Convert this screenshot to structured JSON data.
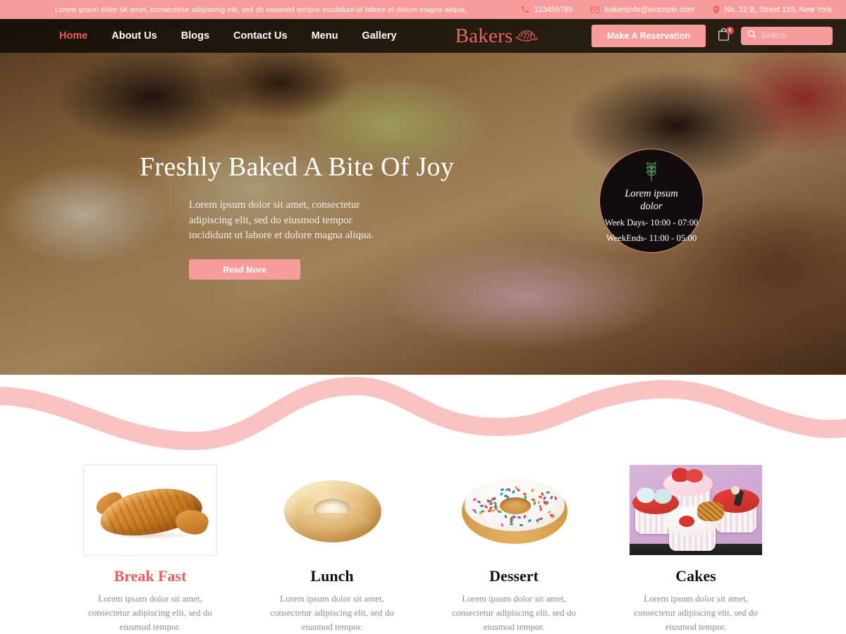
{
  "topbar": {
    "tagline": "Lorem ipsum dolor sit amet, consectetur adipiscing elit, sed do eiusmod tempor incididunt ut labore et dolore magna aliqua.",
    "phone": "123456789",
    "email": "bakersinfo@example.com",
    "address": "No. 22 B, Street 123, New York"
  },
  "nav": {
    "links": [
      {
        "label": "Home",
        "active": true
      },
      {
        "label": "About Us",
        "active": false
      },
      {
        "label": "Blogs",
        "active": false
      },
      {
        "label": "Contact Us",
        "active": false
      },
      {
        "label": "Menu",
        "active": false
      },
      {
        "label": "Gallery",
        "active": false
      }
    ],
    "brand": "Bakers",
    "reserve_label": "Make A Reservation",
    "cart_badge": "0",
    "search_placeholder": "Search",
    "search_value": ""
  },
  "hero": {
    "title": "Freshly Baked A Bite Of Joy",
    "description": "Lorem ipsum dolor sit amet, consectetur adipiscing elit, sed do eiusmod tempor incididunt ut labore et dolore magna aliqua.",
    "cta_label": "Read More",
    "hours": {
      "title": "Lorem ipsum dolor",
      "weekdays": "Week Days- 10:00 - 07:00",
      "weekends": "WeekEnds- 11:00 - 05:00"
    }
  },
  "categories": [
    {
      "title": "Break Fast",
      "description": "Lorem ipsum dolor sit amet, consectetur adipiscing elit, sed do eiusmod tempor.",
      "image": "croissant-photo",
      "accent": true
    },
    {
      "title": "Lunch",
      "description": "Lorem ipsum dolor sit amet, consectetur adipiscing elit, sed do eiusmod tempor.",
      "image": "bagel-photo",
      "accent": false
    },
    {
      "title": "Dessert",
      "description": "Lorem ipsum dolor sit amet, consectetur adipiscing elit, sed do eiusmod tempor.",
      "image": "sprinkle-donut-photo",
      "accent": false
    },
    {
      "title": "Cakes",
      "description": "Lorem ipsum dolor sit amet, consectetur adipiscing elit, sed do eiusmod tempor.",
      "image": "cupcakes-photo",
      "accent": false
    }
  ],
  "colors": {
    "brand_pink": "#f79b9b",
    "accent_red": "#ef5a5a",
    "wave_pink": "#f9c3c3",
    "dark_nav": "#0a0604"
  }
}
